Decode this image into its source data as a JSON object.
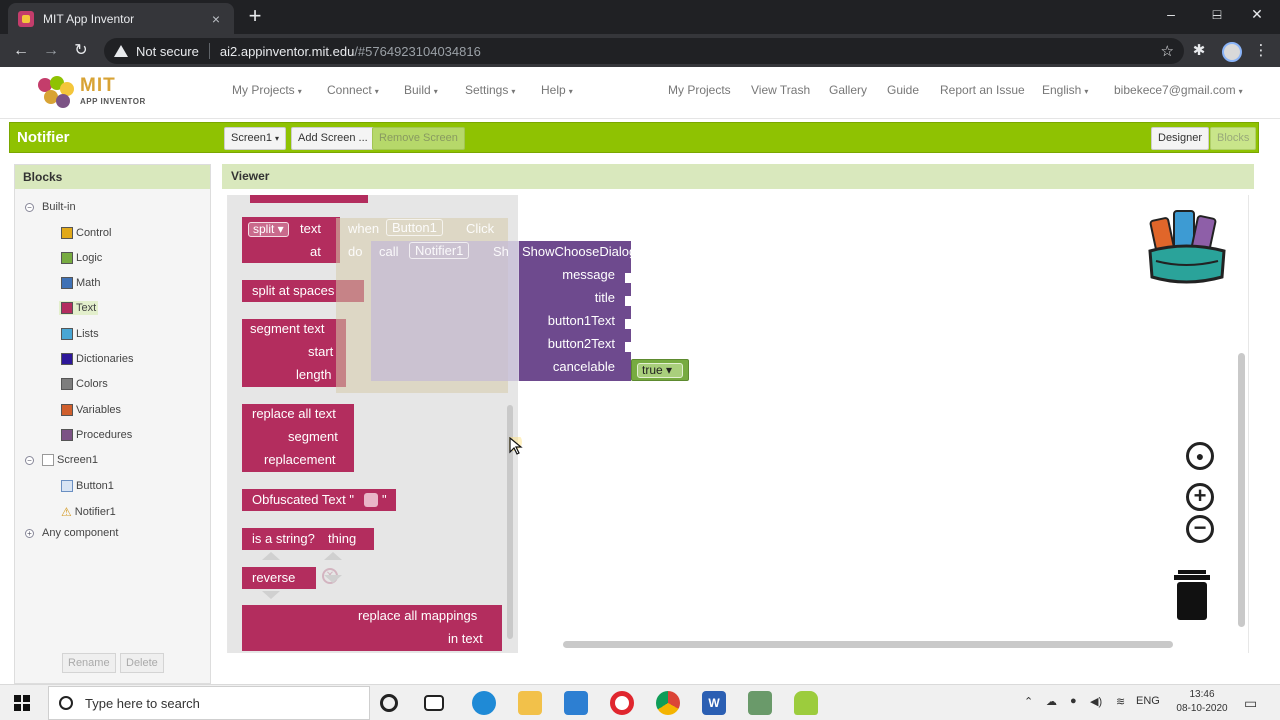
{
  "browser": {
    "tab_title": "MIT App Inventor",
    "tab_close": "×",
    "new_tab": "+",
    "security_label": "Not secure",
    "host": "ai2.appinventor.mit.edu",
    "path": "/#5764923104034816",
    "win_min": "–",
    "win_max": "□",
    "win_close": "✕"
  },
  "app_header": {
    "logo_title": "MIT",
    "logo_subtitle": "APP INVENTOR",
    "menu_left": [
      "My Projects",
      "Connect",
      "Build",
      "Settings",
      "Help"
    ],
    "menu_right": [
      "My Projects",
      "View Trash",
      "Gallery",
      "Guide",
      "Report an Issue",
      "English",
      "bibekece7@gmail.com"
    ]
  },
  "project_bar": {
    "title": "Notifier",
    "screen_select": "Screen1",
    "add_screen": "Add Screen ...",
    "remove_screen": "Remove Screen",
    "designer": "Designer",
    "blocks": "Blocks"
  },
  "blocks_panel": {
    "header": "Blocks",
    "builtin_label": "Built-in",
    "builtin_items": [
      {
        "label": "Control",
        "color": "#e1a91a"
      },
      {
        "label": "Logic",
        "color": "#77ab41"
      },
      {
        "label": "Math",
        "color": "#3f71b5"
      },
      {
        "label": "Text",
        "color": "#b32d5e"
      },
      {
        "label": "Lists",
        "color": "#49a6d4"
      },
      {
        "label": "Dictionaries",
        "color": "#2d1799"
      },
      {
        "label": "Colors",
        "color": "#7d7d7d"
      },
      {
        "label": "Variables",
        "color": "#d05f2d"
      },
      {
        "label": "Procedures",
        "color": "#7c5385"
      }
    ],
    "screen_label": "Screen1",
    "components": [
      "Button1",
      "Notifier1"
    ],
    "any_component": "Any component",
    "rename_button": "Rename",
    "delete_button": "Delete"
  },
  "viewer": {
    "header": "Viewer",
    "flyout_blocks": {
      "split": "split",
      "split_text": "text",
      "split_at": "at",
      "split_at_spaces": "split at spaces",
      "segment_text": "segment text",
      "segment_start": "start",
      "segment_length": "length",
      "replace_all_text": "replace all text",
      "replace_segment": "segment",
      "replace_replacement": "replacement",
      "obfuscated_text": "Obfuscated Text \"",
      "obfuscated_close": "\"",
      "is_a_string": "is a string?",
      "thing": "thing",
      "reverse": "reverse",
      "replace_all_mappings": "replace all mappings",
      "in_text": "in text"
    },
    "ghost_event": {
      "when": "when",
      "component": "Button1",
      "event": "Click",
      "do": "do",
      "call": "call",
      "notifier": "Notifier1"
    },
    "method_block": {
      "name": "ShowChooseDialog",
      "prefix": "Sh",
      "params": [
        "message",
        "title",
        "button1Text",
        "button2Text",
        "cancelable"
      ]
    },
    "logic_value": "true"
  },
  "taskbar": {
    "search_placeholder": "Type here to search",
    "lang": "ENG",
    "time": "13:46",
    "date": "08-10-2020"
  }
}
